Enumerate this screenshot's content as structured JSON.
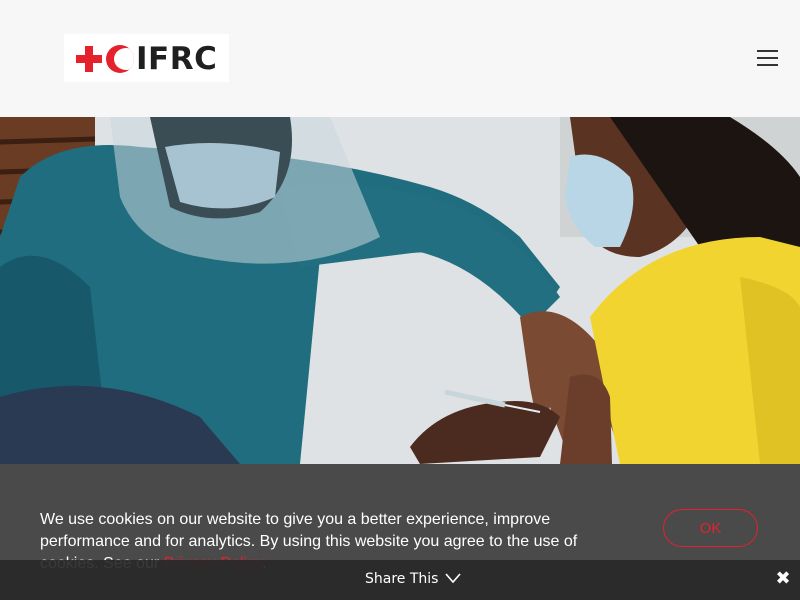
{
  "header": {
    "logo_text": "IFRC",
    "menu_icon": "hamburger-menu-icon"
  },
  "hero": {
    "image_description_icon": "vaccination-photo"
  },
  "cookie_banner": {
    "text_before_link": "We use cookies on our website to give you a better experience, improve performance and for analytics. By using this website you agree to the use of cookies. See our ",
    "link_text": "Privacy Policy",
    "text_after_link": ".",
    "ok_label": "OK"
  },
  "share_bar": {
    "label": "Share This",
    "chevron_icon": "chevron-down-icon",
    "close_icon": "close-icon"
  },
  "colors": {
    "brand_red": "#e5212b",
    "banner_bg": "#4a4a4a",
    "header_bg": "#f7f7f7"
  }
}
